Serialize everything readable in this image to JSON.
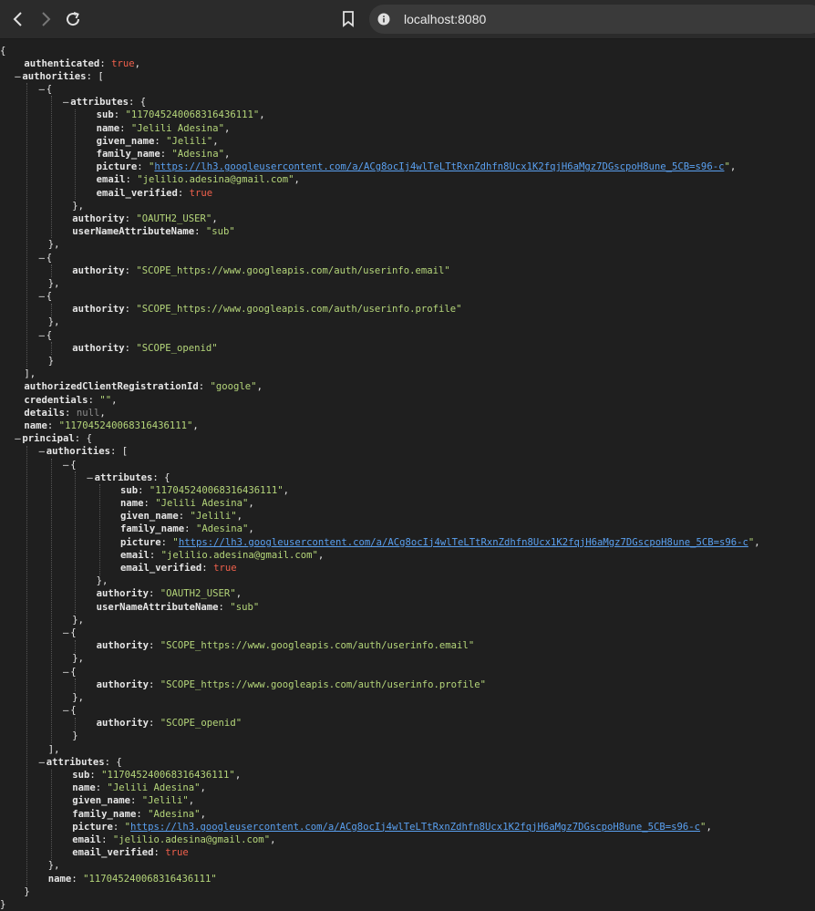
{
  "browser": {
    "url": "localhost:8080",
    "icons": {
      "back": "back-arrow-icon",
      "forward": "forward-arrow-icon",
      "reload": "reload-icon",
      "bookmark": "bookmark-icon",
      "site_info": "site-info-icon"
    }
  },
  "colors": {
    "key": "#e6e6e6",
    "string": "#b5d67a",
    "boolean": "#f0604c",
    "null": "#8a8a8a",
    "link": "#5aa0f0",
    "background": "#1f1f1f"
  },
  "json": {
    "authenticated": true,
    "authorities": [
      {
        "attributes": {
          "sub": "117045240068316436111",
          "name": "Jelili Adesina",
          "given_name": "Jelili",
          "family_name": "Adesina",
          "picture": "https://lh3.googleusercontent.com/a/ACg8ocIj4wlTeLTtRxnZdhfn8Ucx1K2fqjH6aMgz7DGscpoH8une_5CB=s96-c",
          "email": "jelilio.adesina@gmail.com",
          "email_verified": true
        },
        "authority": "OAUTH2_USER",
        "userNameAttributeName": "sub"
      },
      {
        "authority": "SCOPE_https://www.googleapis.com/auth/userinfo.email"
      },
      {
        "authority": "SCOPE_https://www.googleapis.com/auth/userinfo.profile"
      },
      {
        "authority": "SCOPE_openid"
      }
    ],
    "authorizedClientRegistrationId": "google",
    "credentials": "",
    "details": null,
    "name": "117045240068316436111",
    "principal": {
      "authorities": [
        {
          "attributes": {
            "sub": "117045240068316436111",
            "name": "Jelili Adesina",
            "given_name": "Jelili",
            "family_name": "Adesina",
            "picture": "https://lh3.googleusercontent.com/a/ACg8ocIj4wlTeLTtRxnZdhfn8Ucx1K2fqjH6aMgz7DGscpoH8une_5CB=s96-c",
            "email": "jelilio.adesina@gmail.com",
            "email_verified": true
          },
          "authority": "OAUTH2_USER",
          "userNameAttributeName": "sub"
        },
        {
          "authority": "SCOPE_https://www.googleapis.com/auth/userinfo.email"
        },
        {
          "authority": "SCOPE_https://www.googleapis.com/auth/userinfo.profile"
        },
        {
          "authority": "SCOPE_openid"
        }
      ],
      "attributes": {
        "sub": "117045240068316436111",
        "name": "Jelili Adesina",
        "given_name": "Jelili",
        "family_name": "Adesina",
        "picture": "https://lh3.googleusercontent.com/a/ACg8ocIj4wlTeLTtRxnZdhfn8Ucx1K2fqjH6aMgz7DGscpoH8une_5CB=s96-c",
        "email": "jelilio.adesina@gmail.com",
        "email_verified": true
      },
      "name": "117045240068316436111"
    }
  }
}
